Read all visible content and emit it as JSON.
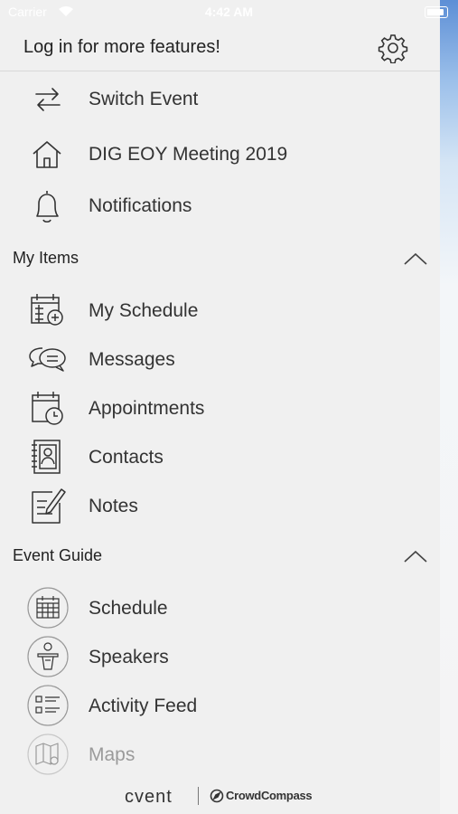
{
  "status_bar": {
    "carrier": "Carrier",
    "time": "4:42 AM"
  },
  "header": {
    "title": "Log in for more features!",
    "settings_icon": "gear-icon"
  },
  "top_items": [
    {
      "label": "Switch Event",
      "icon": "switch-arrows-icon"
    },
    {
      "label": "DIG EOY Meeting 2019",
      "icon": "home-icon"
    },
    {
      "label": "Notifications",
      "icon": "bell-icon"
    }
  ],
  "my_items": {
    "title": "My Items",
    "expanded": true,
    "items": [
      {
        "label": "My Schedule",
        "icon": "calendar-add-icon"
      },
      {
        "label": "Messages",
        "icon": "chat-bubbles-icon"
      },
      {
        "label": "Appointments",
        "icon": "calendar-clock-icon"
      },
      {
        "label": "Contacts",
        "icon": "address-book-icon"
      },
      {
        "label": "Notes",
        "icon": "note-pencil-icon"
      }
    ]
  },
  "event_guide": {
    "title": "Event Guide",
    "expanded": true,
    "items": [
      {
        "label": "Schedule",
        "icon": "calendar-grid-icon"
      },
      {
        "label": "Speakers",
        "icon": "speaker-podium-icon"
      },
      {
        "label": "Activity Feed",
        "icon": "feed-list-icon"
      },
      {
        "label": "Maps",
        "icon": "map-pin-icon"
      }
    ]
  },
  "footer": {
    "brand": "cvent",
    "partner": "CrowdCompass"
  }
}
